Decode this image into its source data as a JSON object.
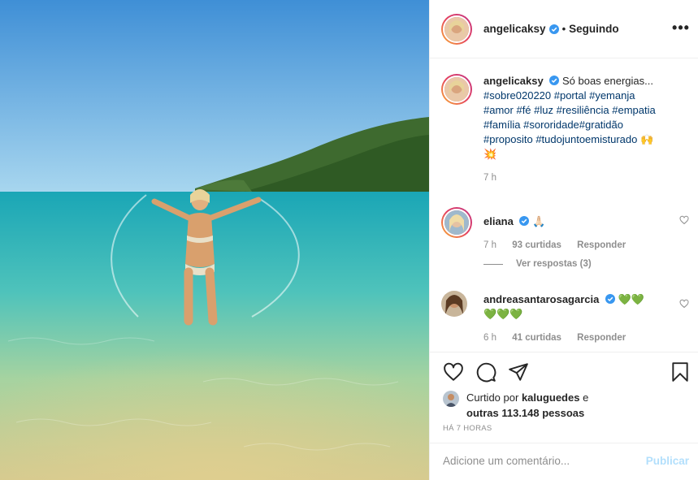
{
  "post": {
    "username": "angelicaksy",
    "follow_label": "Seguindo",
    "more_label": "•••",
    "caption_text": "Só boas energias...",
    "hashtags_line1": "#sobre020220 #portal #yemanja",
    "hashtags_line2": "#amor #fé #luz #resiliência #empatia",
    "hashtags_line3": "#família #sororidade#gratidão",
    "hashtags_line4": "#proposito #tudojuntoemisturado",
    "caption_emoji": "🙌",
    "caption_emoji2": "💥",
    "caption_time": "7 h"
  },
  "comments": [
    {
      "username": "eliana",
      "text": "🙏🏻",
      "time": "7 h",
      "likes": "93 curtidas",
      "reply": "Responder",
      "view_replies": "Ver respostas (3)"
    },
    {
      "username": "andreasantarosagarcia",
      "text": "💚💚",
      "text2": "💚💚💚",
      "time": "6 h",
      "likes": "41 curtidas",
      "reply": "Responder"
    }
  ],
  "likes_info": {
    "prefix": "Curtido por",
    "user": "kaluguedes",
    "connector": "e",
    "others": "outras 113.148 pessoas"
  },
  "timestamp": "HÁ 7 HORAS",
  "comment_box": {
    "placeholder": "Adicione um comentário...",
    "publish_label": "Publicar"
  },
  "icons": [
    "heart-icon",
    "comment-icon",
    "share-icon",
    "bookmark-icon",
    "verified-icon",
    "more-icon"
  ],
  "colors": {
    "link": "#00376b",
    "muted": "#8e8e8e",
    "publish_disabled": "#b2dffc",
    "verified": "#3897f0"
  }
}
